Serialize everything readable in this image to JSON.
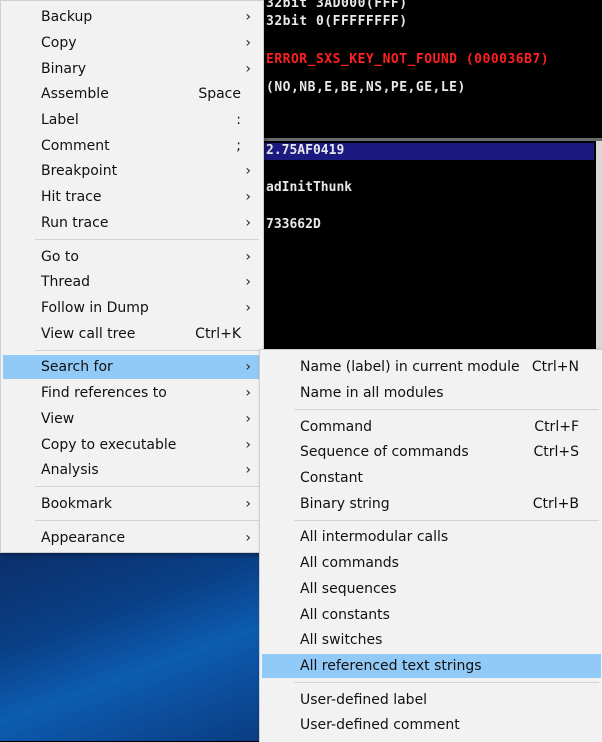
{
  "background": {
    "top_lines": [
      "32bit 3AD000(FFF)",
      "32bit 0(FFFFFFFF)",
      "ERROR_SXS_KEY_NOT_FOUND (000036B7)",
      "(NO,NB,E,BE,NS,PE,GE,LE)"
    ],
    "mid_lines": [
      "2.75AF0419",
      "adInitThunk",
      "733662D"
    ],
    "error_color": "#ff2020",
    "selected_row_color": "#1a1a80"
  },
  "main_menu": {
    "items": [
      {
        "label": "Backup",
        "shortcut": "",
        "submenu": true
      },
      {
        "label": "Copy",
        "shortcut": "",
        "submenu": true
      },
      {
        "label": "Binary",
        "shortcut": "",
        "submenu": true
      },
      {
        "label": "Assemble",
        "shortcut": "Space",
        "submenu": false
      },
      {
        "label": "Label",
        "shortcut": ":",
        "submenu": false
      },
      {
        "label": "Comment",
        "shortcut": ";",
        "submenu": false
      },
      {
        "label": "Breakpoint",
        "shortcut": "",
        "submenu": true
      },
      {
        "label": "Hit trace",
        "shortcut": "",
        "submenu": true
      },
      {
        "label": "Run trace",
        "shortcut": "",
        "submenu": true
      },
      {
        "label": "Go to",
        "shortcut": "",
        "submenu": true
      },
      {
        "label": "Thread",
        "shortcut": "",
        "submenu": true
      },
      {
        "label": "Follow in Dump",
        "shortcut": "",
        "submenu": true
      },
      {
        "label": "View call tree",
        "shortcut": "Ctrl+K",
        "submenu": false
      },
      {
        "label": "Search for",
        "shortcut": "",
        "submenu": true
      },
      {
        "label": "Find references to",
        "shortcut": "",
        "submenu": true
      },
      {
        "label": "View",
        "shortcut": "",
        "submenu": true
      },
      {
        "label": "Copy to executable",
        "shortcut": "",
        "submenu": true
      },
      {
        "label": "Analysis",
        "shortcut": "",
        "submenu": true
      },
      {
        "label": "Bookmark",
        "shortcut": "",
        "submenu": true
      },
      {
        "label": "Appearance",
        "shortcut": "",
        "submenu": true
      }
    ],
    "highlighted": "Search for"
  },
  "sub_menu": {
    "items": [
      {
        "label": "Name (label) in current module",
        "shortcut": "Ctrl+N"
      },
      {
        "label": "Name in all modules",
        "shortcut": ""
      },
      {
        "label": "Command",
        "shortcut": "Ctrl+F"
      },
      {
        "label": "Sequence of commands",
        "shortcut": "Ctrl+S"
      },
      {
        "label": "Constant",
        "shortcut": ""
      },
      {
        "label": "Binary string",
        "shortcut": "Ctrl+B"
      },
      {
        "label": "All intermodular calls",
        "shortcut": ""
      },
      {
        "label": "All commands",
        "shortcut": ""
      },
      {
        "label": "All sequences",
        "shortcut": ""
      },
      {
        "label": "All constants",
        "shortcut": ""
      },
      {
        "label": "All switches",
        "shortcut": ""
      },
      {
        "label": "All referenced text strings",
        "shortcut": ""
      },
      {
        "label": "User-defined label",
        "shortcut": ""
      },
      {
        "label": "User-defined comment",
        "shortcut": ""
      }
    ],
    "highlighted": "All referenced text strings"
  },
  "colors": {
    "menu_bg": "#f2f2f2",
    "highlight": "#91c9f7"
  }
}
